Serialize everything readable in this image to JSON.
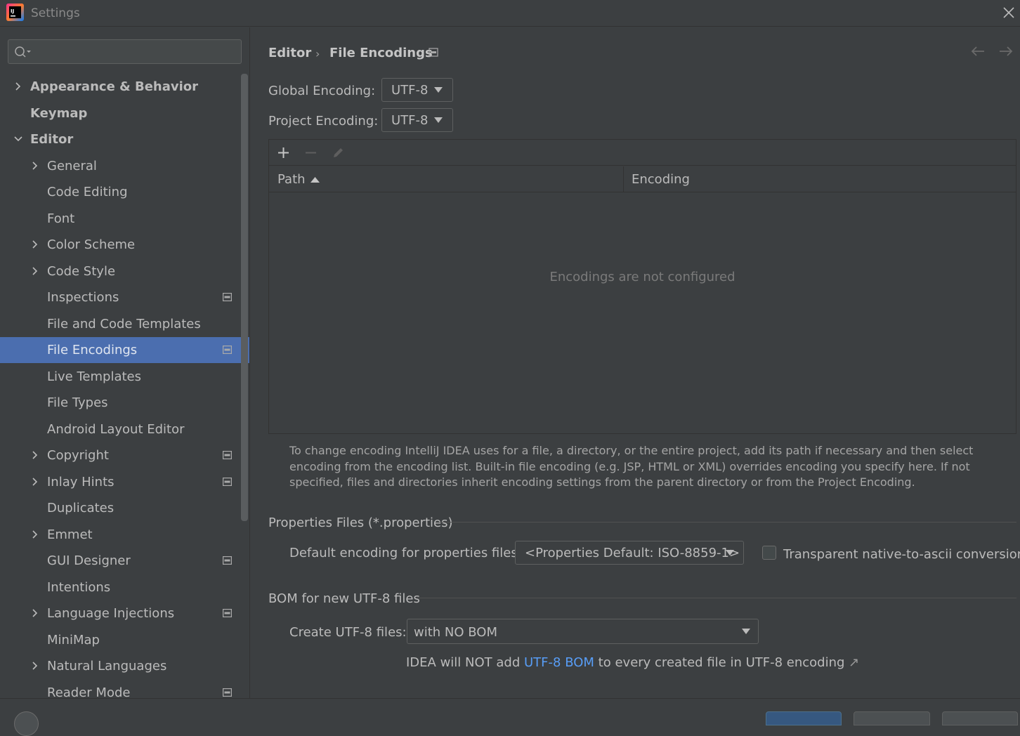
{
  "window": {
    "title": "Settings"
  },
  "colors": {
    "selection": "#4b6eaf",
    "link": "#589df6",
    "background": "#3c3f41"
  },
  "search": {
    "placeholder": "",
    "value": ""
  },
  "sidebar": {
    "items": [
      {
        "label": "Appearance & Behavior",
        "level": 0,
        "expandable": true,
        "expanded": false,
        "bold": true,
        "project_icon": false
      },
      {
        "label": "Keymap",
        "level": 0,
        "expandable": false,
        "bold": true,
        "project_icon": false
      },
      {
        "label": "Editor",
        "level": 0,
        "expandable": true,
        "expanded": true,
        "bold": true,
        "project_icon": false
      },
      {
        "label": "General",
        "level": 1,
        "expandable": true,
        "expanded": false,
        "project_icon": false
      },
      {
        "label": "Code Editing",
        "level": 1,
        "expandable": false,
        "project_icon": false
      },
      {
        "label": "Font",
        "level": 1,
        "expandable": false,
        "project_icon": false
      },
      {
        "label": "Color Scheme",
        "level": 1,
        "expandable": true,
        "expanded": false,
        "project_icon": false
      },
      {
        "label": "Code Style",
        "level": 1,
        "expandable": true,
        "expanded": false,
        "project_icon": false
      },
      {
        "label": "Inspections",
        "level": 1,
        "expandable": false,
        "project_icon": true
      },
      {
        "label": "File and Code Templates",
        "level": 1,
        "expandable": false,
        "project_icon": false
      },
      {
        "label": "File Encodings",
        "level": 1,
        "expandable": false,
        "project_icon": true,
        "selected": true
      },
      {
        "label": "Live Templates",
        "level": 1,
        "expandable": false,
        "project_icon": false
      },
      {
        "label": "File Types",
        "level": 1,
        "expandable": false,
        "project_icon": false
      },
      {
        "label": "Android Layout Editor",
        "level": 1,
        "expandable": false,
        "project_icon": false
      },
      {
        "label": "Copyright",
        "level": 1,
        "expandable": true,
        "expanded": false,
        "project_icon": true
      },
      {
        "label": "Inlay Hints",
        "level": 1,
        "expandable": true,
        "expanded": false,
        "project_icon": true
      },
      {
        "label": "Duplicates",
        "level": 1,
        "expandable": false,
        "project_icon": false
      },
      {
        "label": "Emmet",
        "level": 1,
        "expandable": true,
        "expanded": false,
        "project_icon": false
      },
      {
        "label": "GUI Designer",
        "level": 1,
        "expandable": false,
        "project_icon": true
      },
      {
        "label": "Intentions",
        "level": 1,
        "expandable": false,
        "project_icon": false
      },
      {
        "label": "Language Injections",
        "level": 1,
        "expandable": true,
        "expanded": false,
        "project_icon": true
      },
      {
        "label": "MiniMap",
        "level": 1,
        "expandable": false,
        "project_icon": false
      },
      {
        "label": "Natural Languages",
        "level": 1,
        "expandable": true,
        "expanded": false,
        "project_icon": false
      },
      {
        "label": "Reader Mode",
        "level": 1,
        "expandable": false,
        "project_icon": true
      }
    ]
  },
  "breadcrumb": {
    "parent": "Editor",
    "separator": "›",
    "current": "File Encodings"
  },
  "encodings": {
    "global_label": "Global Encoding:",
    "global_value": "UTF-8",
    "project_label": "Project Encoding:",
    "project_value": "UTF-8"
  },
  "table": {
    "columns": [
      "Path",
      "Encoding"
    ],
    "sort_column": "Path",
    "empty_text": "Encodings are not configured"
  },
  "help_text": "To change encoding IntelliJ IDEA uses for a file, a directory, or the entire project, add its path if necessary and then select encoding from the encoding list. Built-in file encoding (e.g. JSP, HTML or XML) overrides encoding you specify here. If not specified, files and directories inherit encoding settings from the parent directory or from the Project Encoding.",
  "properties": {
    "section_title": "Properties Files (*.properties)",
    "default_label": "Default encoding for properties files:",
    "default_value": "<Properties Default: ISO-8859-1>",
    "transparent_label": "Transparent native-to-ascii conversion",
    "transparent_checked": false
  },
  "bom": {
    "section_title": "BOM for new UTF-8 files",
    "create_label": "Create UTF-8 files:",
    "create_value": "with NO BOM",
    "note_prefix": "IDEA will NOT add",
    "note_link": "UTF-8 BOM",
    "note_suffix": "to every created file in UTF-8 encoding",
    "note_ext_icon": "↗"
  }
}
